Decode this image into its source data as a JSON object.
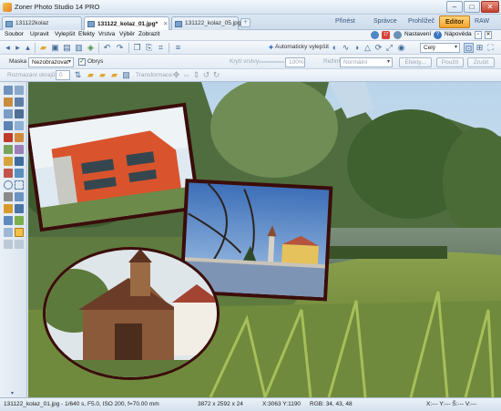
{
  "window": {
    "title": "Zoner Photo Studio 14 PRO",
    "minimize": "–",
    "maximize": "□",
    "close": "✕"
  },
  "tabs": [
    {
      "label": "131122kolaz"
    },
    {
      "label": "131122_kolaz_01.jpg*"
    },
    {
      "label": "131122_kolaz_05.jpg"
    }
  ],
  "modes": {
    "prinest": "Přinést",
    "spravce": "Správce",
    "prohlizec": "Prohlížeč",
    "editor": "Editor",
    "raw": "RAW"
  },
  "menu": {
    "items": [
      "Soubor",
      "Upravit",
      "Vylepšit",
      "Efekty",
      "Vrstva",
      "Výběr",
      "Zobrazit"
    ],
    "settings": "Nastavení",
    "help": "Nápověda"
  },
  "toolbar": {
    "auto_enhance": "Automaticky vylepšit",
    "zoom": "Celý"
  },
  "options": {
    "mask_label": "Maska",
    "mask_value": "Nezobrazovat",
    "outline_label": "Obrys",
    "opacity_label": "Krytí vrstvy:",
    "opacity_value": "100%",
    "mode_label": "Režim:",
    "mode_value": "Normální",
    "effects": "Efekty...",
    "apply": "Použít",
    "cancel": "Zrušit"
  },
  "options2": {
    "blur_label": "Rozmazání okrajů",
    "blur_value": "0",
    "transform_label": "Transformace:"
  },
  "status": {
    "file": "131122_kolaz_01.jpg - 1/640 s, F5.0, ISO 200, f=70.00 mm",
    "dims": "3872 x 2592 x 24",
    "coords": "X:3063 Y:1190",
    "rgb": "RGB: 34, 43, 48",
    "sel": "X:--- Y:--- Š:--- V:---"
  }
}
